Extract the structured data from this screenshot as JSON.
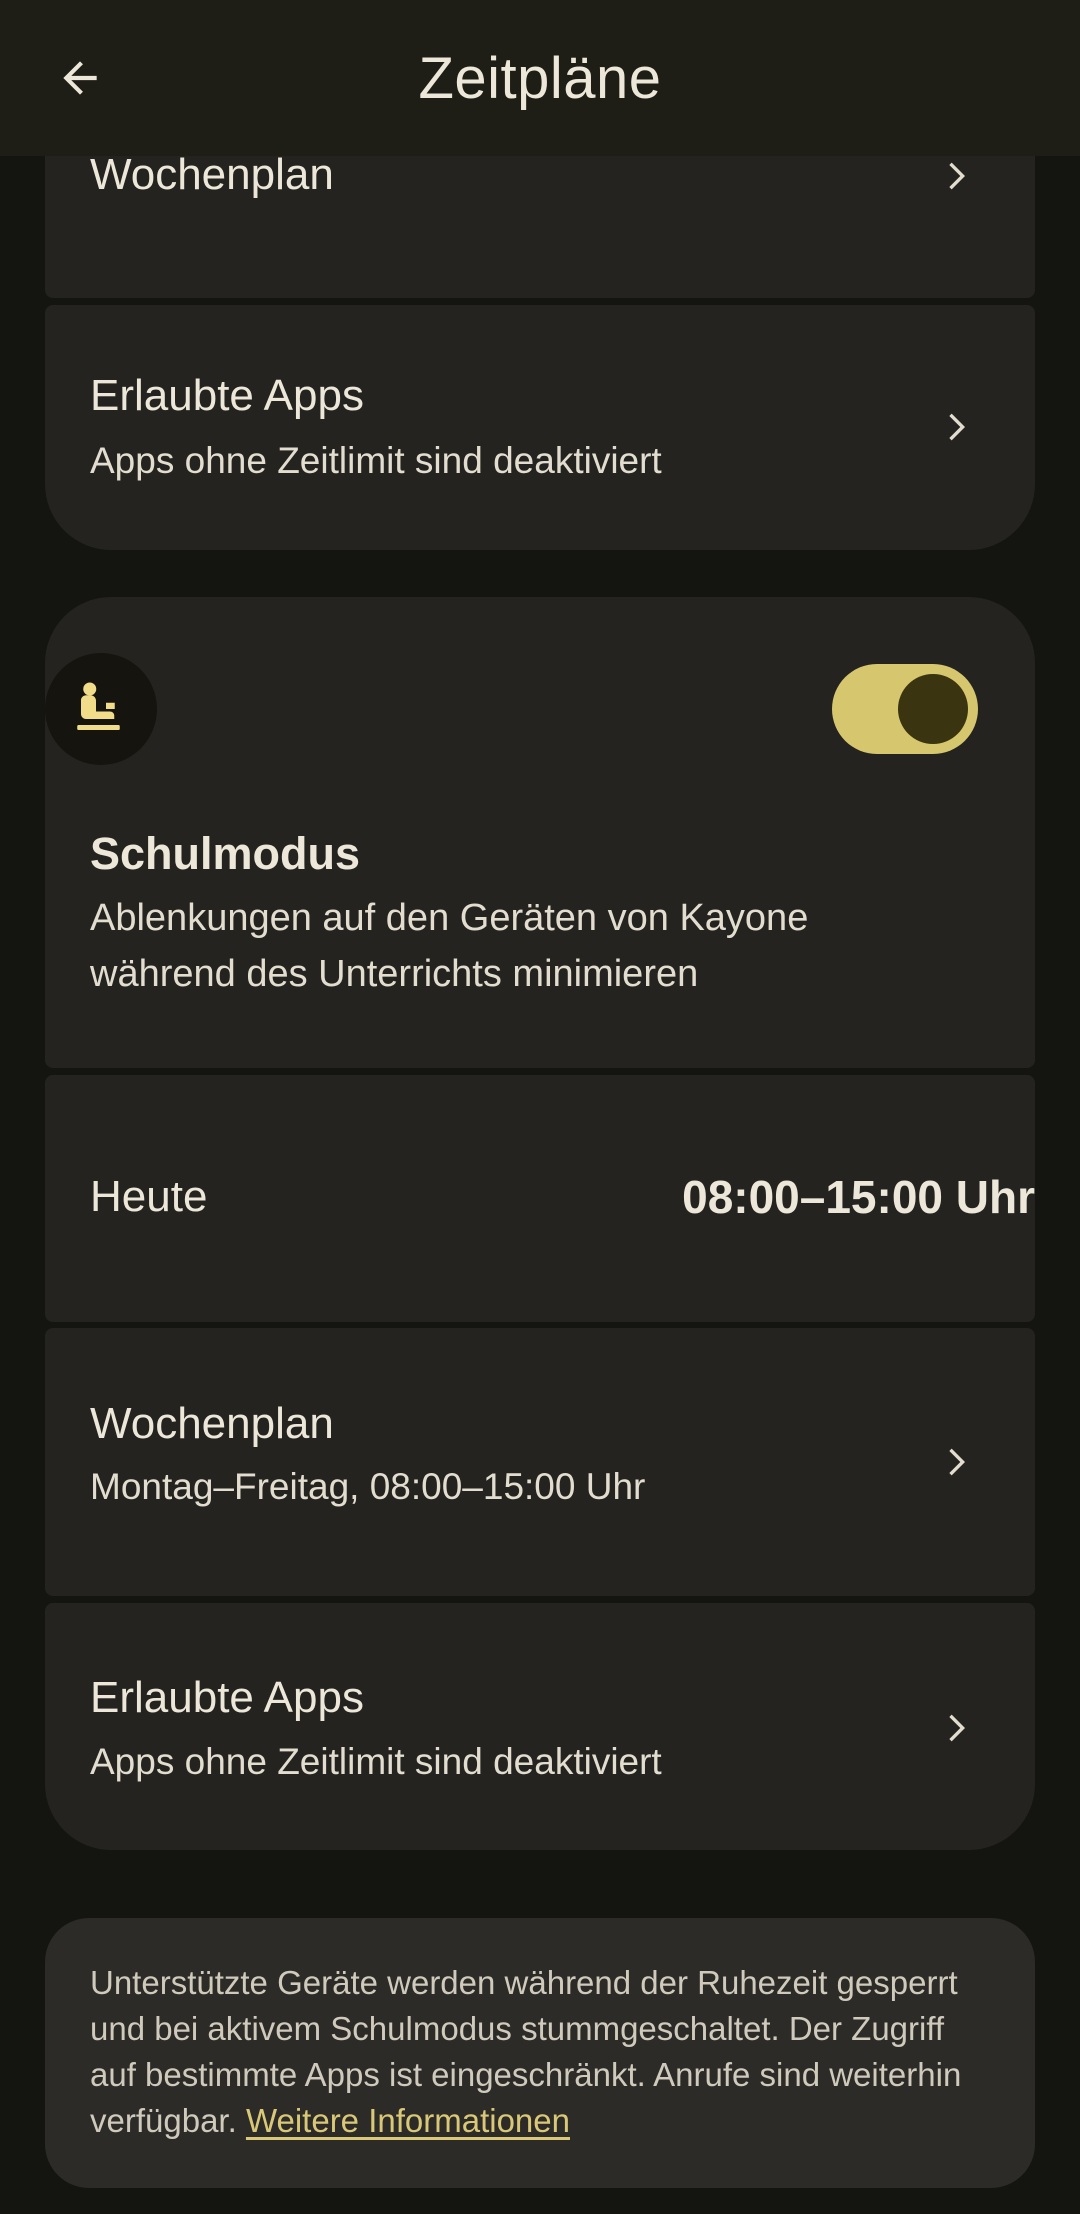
{
  "appbar": {
    "title": "Zeitpläne",
    "back_icon": "arrow-left-icon"
  },
  "bedtime_section": {
    "weekly_plan": {
      "title": "Wochenplan"
    },
    "allowed_apps": {
      "title": "Erlaubte Apps",
      "subtitle": "Apps ohne Zeitlimit sind deaktiviert"
    }
  },
  "school_mode": {
    "icon": "student-at-desk-icon",
    "toggle_on": true,
    "title": "Schulmodus",
    "description_line1": "Ablenkungen auf den Geräten von Kayone",
    "description_line2": "während des Unterrichts minimieren",
    "today": {
      "label": "Heute",
      "value": "08:00–15:00 Uhr"
    },
    "weekly_plan": {
      "title": "Wochenplan",
      "subtitle": "Montag–Freitag, 08:00–15:00 Uhr"
    },
    "allowed_apps": {
      "title": "Erlaubte Apps",
      "subtitle": "Apps ohne Zeitlimit sind deaktiviert"
    }
  },
  "info": {
    "text": "Unterstützte Geräte werden während der Ruhezeit gesperrt und bei aktivem Schulmodus stummgeschaltet. Der Zugriff auf bestimmte Apps ist eingeschränkt. Anrufe sind weiterhin verfügbar.",
    "link": "Weitere Informationen"
  },
  "colors": {
    "background": "#141410",
    "card": "#242320",
    "accent": "#d6c66e",
    "link": "#d9c877"
  }
}
